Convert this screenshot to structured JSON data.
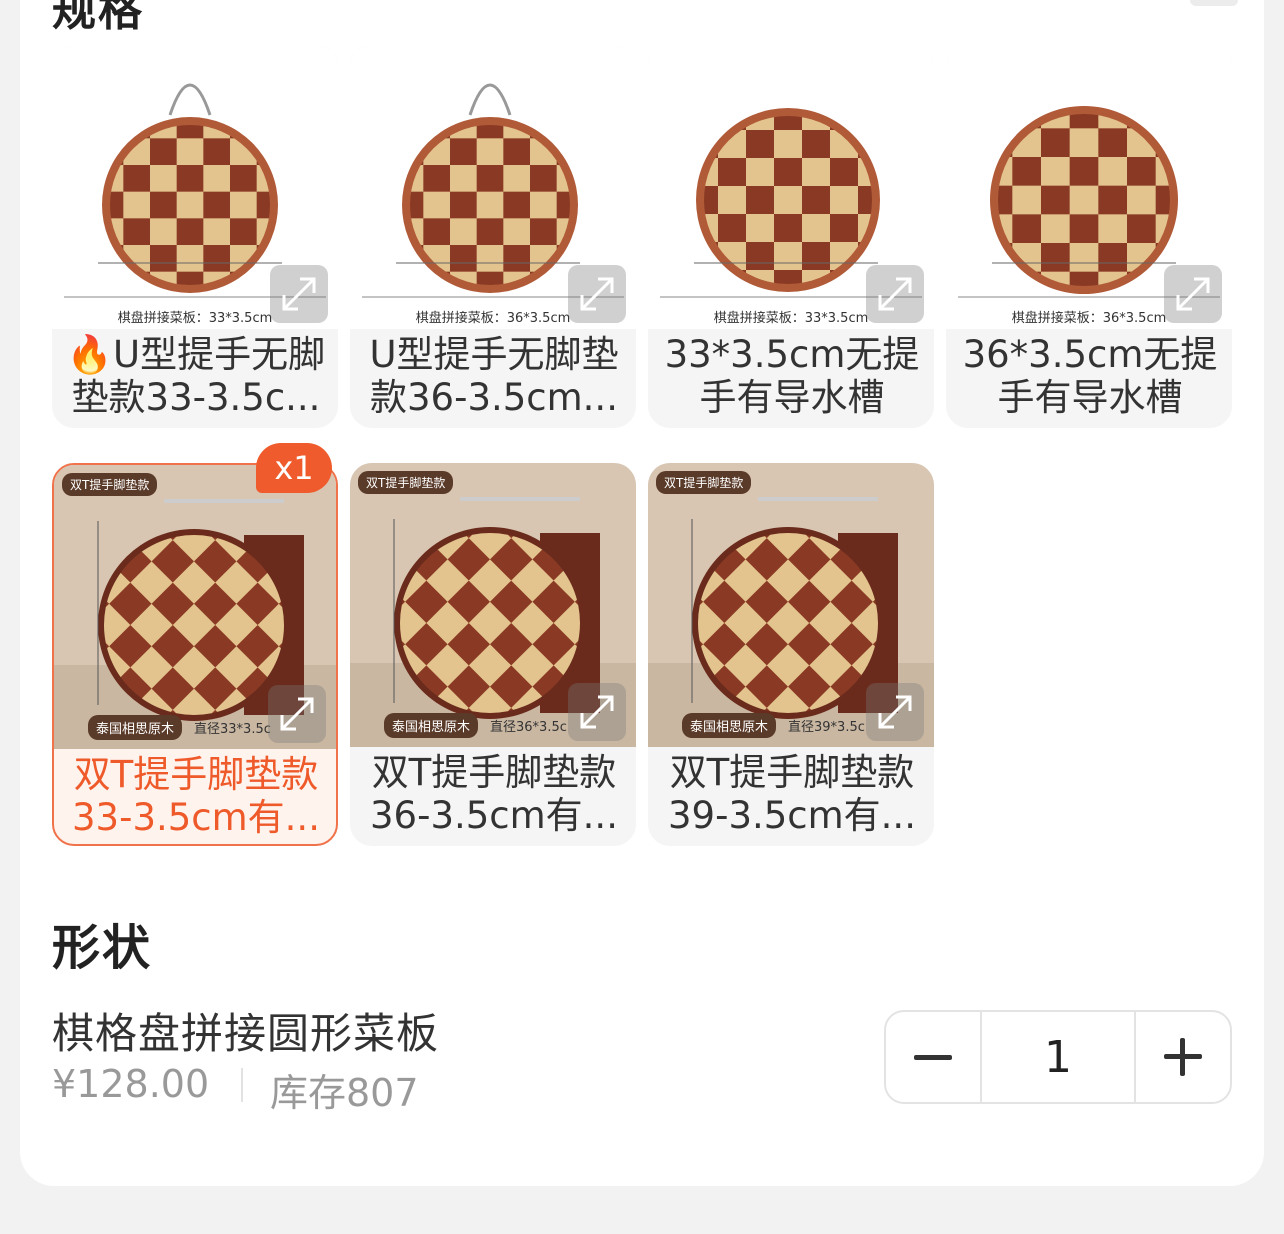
{
  "section_spec": {
    "title": "规格"
  },
  "variants": [
    {
      "label": "U型提手无脚垫款33-3.5c...",
      "hot": true,
      "selected": false,
      "caption": "棋盘拼接菜板：33*3.5cm"
    },
    {
      "label": "U型提手无脚垫款36-3.5cm...",
      "hot": false,
      "selected": false,
      "caption": "棋盘拼接菜板：36*3.5cm"
    },
    {
      "label": "33*3.5cm无提手有导水槽",
      "hot": false,
      "selected": false,
      "caption": "棋盘拼接菜板：33*3.5cm"
    },
    {
      "label": "36*3.5cm无提手有导水槽",
      "hot": false,
      "selected": false,
      "caption": "棋盘拼接菜板：36*3.5cm"
    },
    {
      "label": "双T提手脚垫款33-3.5cm有...",
      "hot": false,
      "selected": true,
      "count_badge": "x1",
      "tag_top": "双T提手脚垫款",
      "tag_bottom": "泰国相思原木",
      "diameter": "直径33*3.5c"
    },
    {
      "label": "双T提手脚垫款36-3.5cm有...",
      "hot": false,
      "selected": false,
      "tag_top": "双T提手脚垫款",
      "tag_bottom": "泰国相思原木",
      "diameter": "直径36*3.5c"
    },
    {
      "label": "双T提手脚垫款39-3.5cm有...",
      "hot": false,
      "selected": false,
      "tag_top": "双T提手脚垫款",
      "tag_bottom": "泰国相思原木",
      "diameter": "直径39*3.5c"
    }
  ],
  "section_shape": {
    "title": "形状"
  },
  "product": {
    "name": "棋格盘拼接圆形菜板",
    "price": "¥128.00",
    "stock": "库存807"
  },
  "stepper": {
    "value": "1"
  },
  "colors": {
    "accent": "#ef5b2c",
    "wood_light": "#e4c48e",
    "wood_dark": "#8a3a24"
  }
}
